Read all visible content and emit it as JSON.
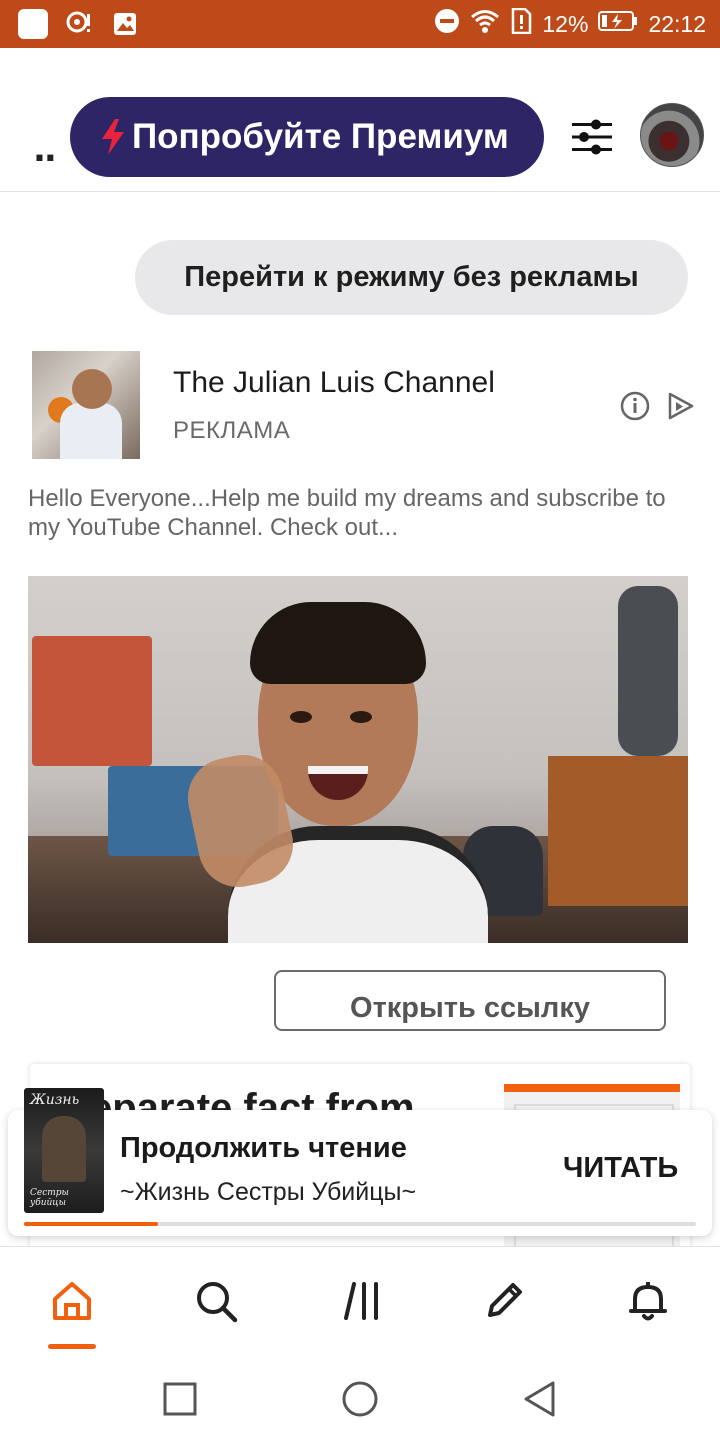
{
  "status_bar": {
    "battery_percent": "12%",
    "time": "22:12"
  },
  "header": {
    "overflow": "..",
    "premium_label": "Попробуйте Премиум"
  },
  "ad_free_label": "Перейти к режиму без рекламы",
  "ad": {
    "channel_name": "The Julian Luis Channel",
    "label": "РЕКЛАМА",
    "description": "Hello Everyone...Help me build my dreams and subscribe to my YouTube Channel. Check out...",
    "open_link_label": "Открыть ссылку"
  },
  "next_story": {
    "title_fragment": "eparate fact from"
  },
  "continue_reading": {
    "title": "Продолжить чтение",
    "story_title": "~Жизнь Сестры Убийцы~",
    "read_label": "ЧИТАТЬ",
    "progress_fraction": 0.2,
    "cover_title": "Жизнь",
    "cover_subtitle": "Сестры убийцы"
  },
  "bottom_nav": {
    "items": [
      "home-icon",
      "search-icon",
      "library-icon",
      "write-icon",
      "notifications-icon"
    ],
    "active": "home-icon"
  },
  "colors": {
    "status_bar": "#bf4a19",
    "premium_bg": "#2e2567",
    "accent": "#f0600f",
    "bolt": "#e8233a"
  }
}
